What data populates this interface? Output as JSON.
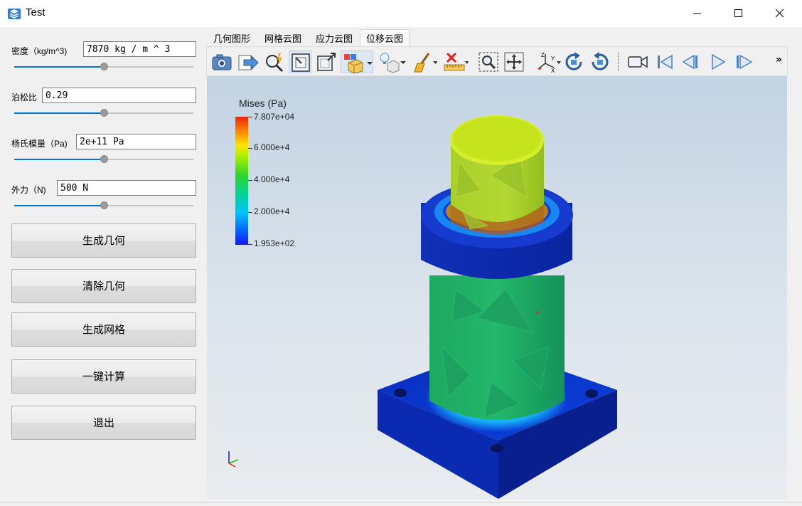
{
  "window": {
    "title": "Test"
  },
  "params": [
    {
      "label": "密度（kg/m^3)",
      "value": "7870 kg / m ^ 3",
      "slider_fraction": 0.5
    },
    {
      "label": "泊松比",
      "value": "0.29",
      "slider_fraction": 0.5
    },
    {
      "label": "杨氏模量（Pa)",
      "value": "2e+11 Pa",
      "slider_fraction": 0.5
    },
    {
      "label": "外力（N)",
      "value": "500 N",
      "slider_fraction": 0.5
    }
  ],
  "buttons": {
    "generate_geometry": "生成几何",
    "clear_geometry": "清除几何",
    "generate_mesh": "生成网格",
    "compute": "一键计算",
    "exit": "退出"
  },
  "tabs": [
    "几何图形",
    "网格云图",
    "应力云图",
    "位移云图"
  ],
  "active_tab": "位移云图",
  "toolbar": {
    "icons": [
      "camera-icon",
      "export-arrow-icon",
      "zoom-magic-icon",
      "zoom-box-icon",
      "zoom-extent-icon",
      "display-mode-icon",
      "light-icon",
      "clear-brush-icon",
      "ruler-delete-icon",
      "zoom-window-icon",
      "fit-view-icon",
      "axes-icon",
      "rotate-cw-icon",
      "rotate-ccw-icon",
      "video-camera-icon",
      "first-frame-icon",
      "prev-frame-icon",
      "play-icon",
      "next-frame-icon"
    ],
    "overflow": "»"
  },
  "legend": {
    "title": "Mises (Pa)",
    "labels": [
      "7.807e+04",
      "6.000e+4",
      "4.000e+4",
      "2.000e+4",
      "1.953e+02"
    ],
    "min": 195.3,
    "max": 78070
  },
  "axes_triad": {
    "labels": [
      "x",
      "y",
      "z"
    ]
  },
  "colors": {
    "accent": "#0078d7",
    "viewport_top": "#c3d3e3",
    "viewport_bottom": "#e8ecef"
  }
}
